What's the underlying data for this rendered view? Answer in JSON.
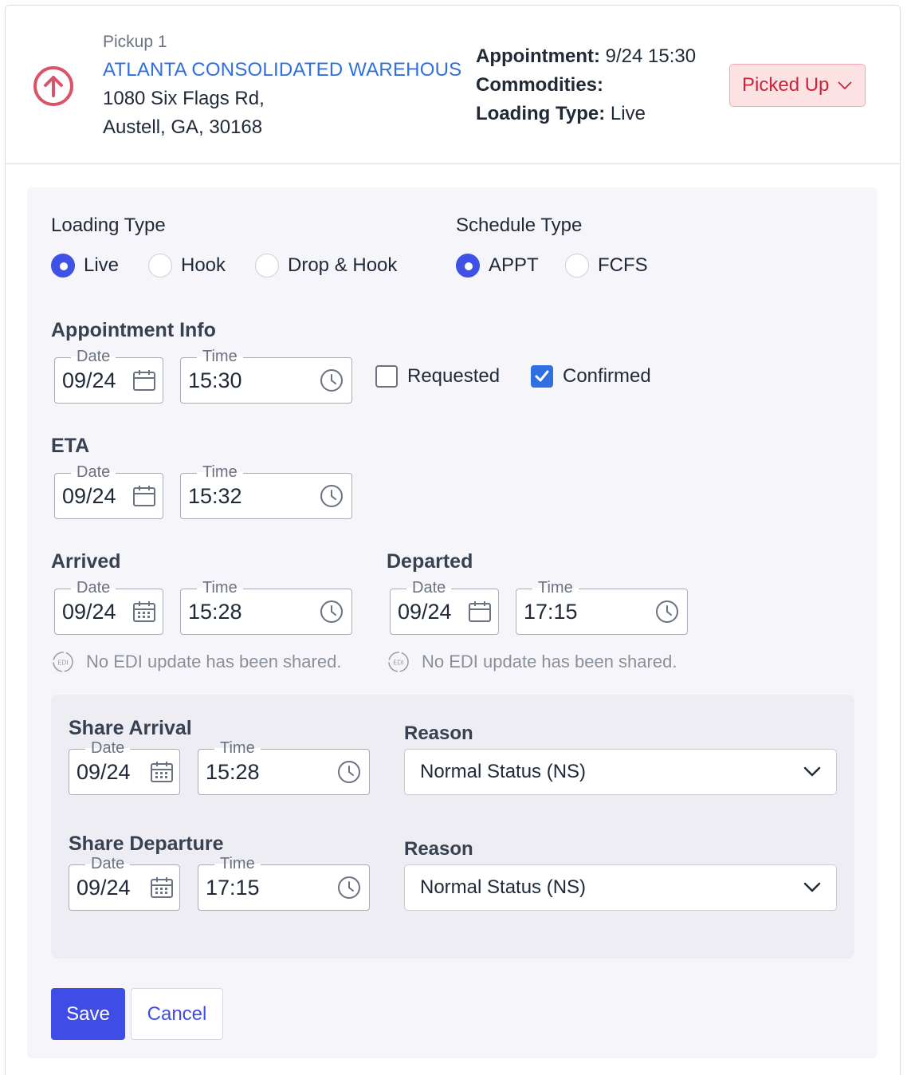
{
  "header": {
    "stop_label": "Pickup 1",
    "stop_name": "ATLANTA CONSOLIDATED WAREHOUS",
    "address_line1": "1080 Six Flags Rd,",
    "address_line2": "Austell, GA, 30168",
    "appointment_label": "Appointment:",
    "appointment_value": "9/24 15:30",
    "commodities_label": "Commodities:",
    "commodities_value": "",
    "loading_type_label": "Loading Type:",
    "loading_type_value": "Live",
    "status": "Picked Up",
    "status_color": "#c8243a",
    "icon": "arrow-up-circle-icon"
  },
  "loading_type": {
    "title": "Loading Type",
    "options": [
      "Live",
      "Hook",
      "Drop & Hook"
    ],
    "selected": "Live"
  },
  "schedule_type": {
    "title": "Schedule Type",
    "options": [
      "APPT",
      "FCFS"
    ],
    "selected": "APPT"
  },
  "appointment": {
    "title": "Appointment Info",
    "date_label": "Date",
    "date": "09/24",
    "time_label": "Time",
    "time": "15:30",
    "requested_label": "Requested",
    "requested": false,
    "confirmed_label": "Confirmed",
    "confirmed": true
  },
  "eta": {
    "title": "ETA",
    "date_label": "Date",
    "date": "09/24",
    "time_label": "Time",
    "time": "15:32"
  },
  "arrived": {
    "title": "Arrived",
    "date_label": "Date",
    "date": "09/24",
    "time_label": "Time",
    "time": "15:28",
    "edi_note": "No EDI update has been shared."
  },
  "departed": {
    "title": "Departed",
    "date_label": "Date",
    "date": "09/24",
    "time_label": "Time",
    "time": "17:15",
    "edi_note": "No EDI update has been shared."
  },
  "share_arrival": {
    "title": "Share Arrival",
    "date_label": "Date",
    "date": "09/24",
    "time_label": "Time",
    "time": "15:28",
    "reason_label": "Reason",
    "reason": "Normal Status (NS)"
  },
  "share_departure": {
    "title": "Share Departure",
    "date_label": "Date",
    "date": "09/24",
    "time_label": "Time",
    "time": "17:15",
    "reason_label": "Reason",
    "reason": "Normal Status (NS)"
  },
  "actions": {
    "save": "Save",
    "cancel": "Cancel"
  },
  "colors": {
    "accent": "#3f4de6",
    "link": "#2f6fe0",
    "status_bg": "#fde2e4"
  }
}
